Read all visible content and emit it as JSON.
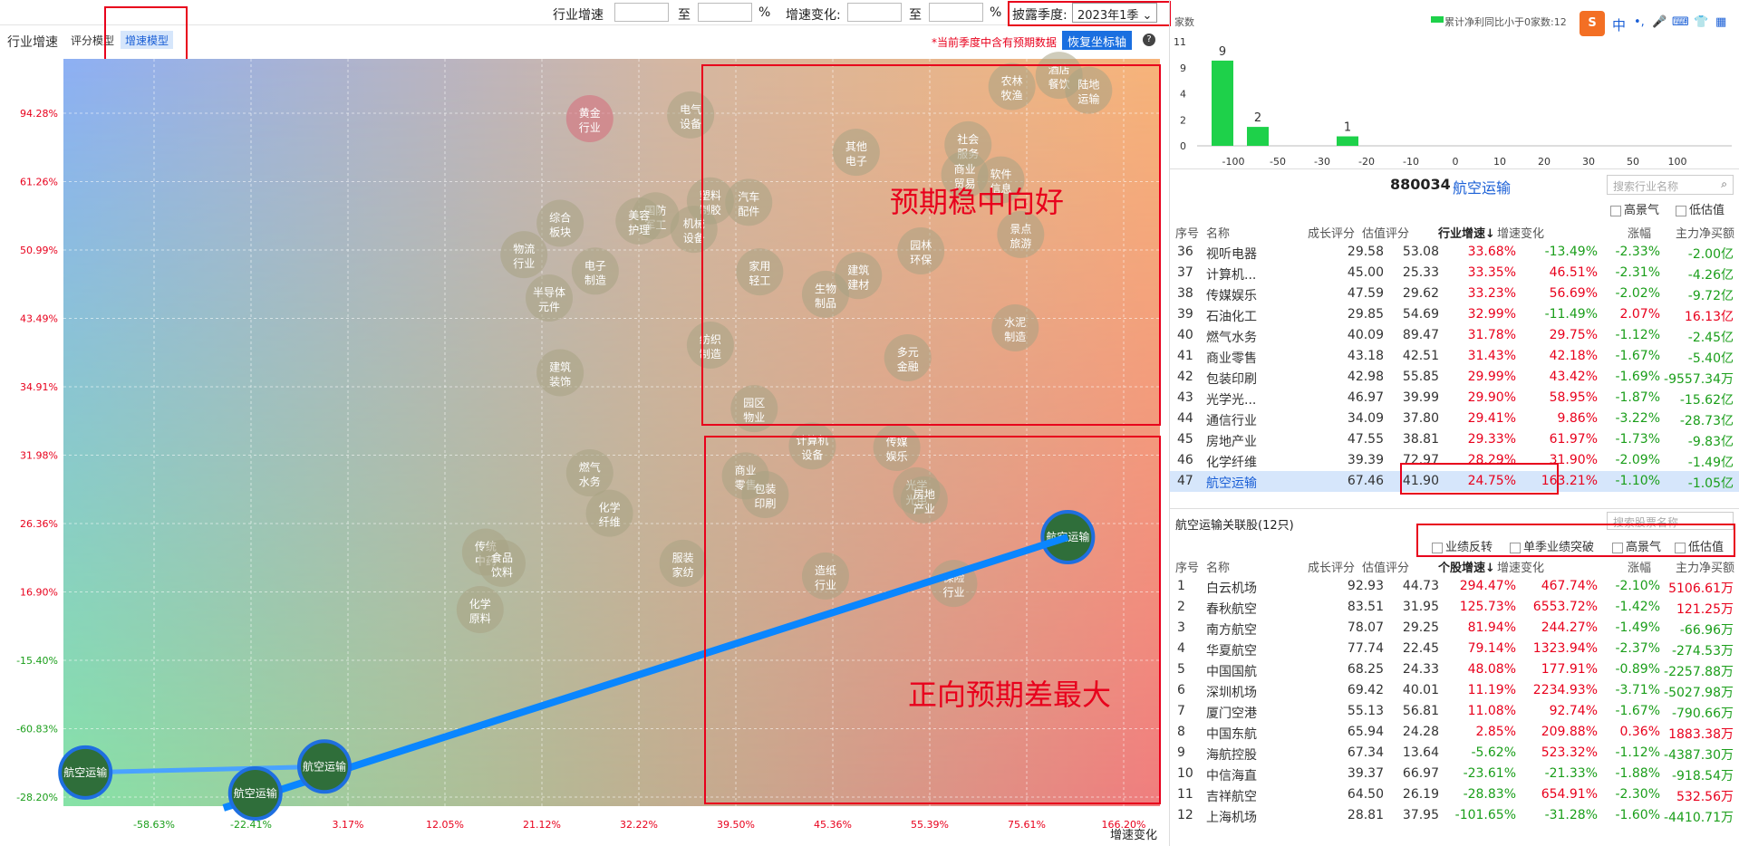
{
  "topbar": {
    "industry_growth_label": "行业增速",
    "to1": "至",
    "pct1": "%",
    "growth_change_label": "增速变化:",
    "to2": "至",
    "pct2": "%",
    "disclosure_label": "披露季度:",
    "disclosure_value": "2023年1季"
  },
  "subbar": {
    "title": "行业增速",
    "tab_score": "评分模型",
    "tab_speed": "增速模型",
    "note": "*当前季度中含有预期数据",
    "restore_button": "恢复坐标轴",
    "help_icon": "?"
  },
  "chart_data": {
    "type": "scatter",
    "xlabel": "增速变化",
    "ylabel": "",
    "x_ticks": [
      "-58.63%",
      "-22.41%",
      "3.17%",
      "12.05%",
      "21.12%",
      "32.22%",
      "39.50%",
      "45.36%",
      "55.39%",
      "75.61%",
      "166.20%"
    ],
    "y_ticks": [
      "94.28%",
      "61.26%",
      "50.99%",
      "43.49%",
      "34.91%",
      "31.98%",
      "26.36%",
      "16.90%",
      "-15.40%",
      "-60.83%",
      "-28.20%"
    ],
    "annotations": [
      "预期稳中向好",
      "正向预期差最大"
    ],
    "bubbles": [
      {
        "name": "黄金行业",
        "x": 0.48,
        "y": 0.92,
        "color": "#d56a7a"
      },
      {
        "name": "电气设备",
        "x": 0.572,
        "y": 0.925,
        "color": "#a7a383"
      },
      {
        "name": "农林牧渔",
        "x": 0.865,
        "y": 0.963,
        "color": "#a7a383"
      },
      {
        "name": "酒店餐饮",
        "x": 0.908,
        "y": 0.978,
        "color": "#a7a383"
      },
      {
        "name": "陆地运输",
        "x": 0.935,
        "y": 0.958,
        "color": "#a7a383"
      },
      {
        "name": "其他电子",
        "x": 0.723,
        "y": 0.875,
        "color": "#a7a383"
      },
      {
        "name": "社会服务",
        "x": 0.825,
        "y": 0.885,
        "color": "#a7a383"
      },
      {
        "name": "商业贸易",
        "x": 0.822,
        "y": 0.845,
        "color": "#a7a383"
      },
      {
        "name": "软件信息",
        "x": 0.855,
        "y": 0.838,
        "color": "#a7a383"
      },
      {
        "name": "塑料制胶",
        "x": 0.59,
        "y": 0.81,
        "color": "#a7a383"
      },
      {
        "name": "汽车配件",
        "x": 0.625,
        "y": 0.808,
        "color": "#a7a383"
      },
      {
        "name": "国防军工",
        "x": 0.54,
        "y": 0.79,
        "color": "#a7a383"
      },
      {
        "name": "美容护理",
        "x": 0.525,
        "y": 0.783,
        "color": "#a7a383"
      },
      {
        "name": "机械设备",
        "x": 0.575,
        "y": 0.772,
        "color": "#a7a383"
      },
      {
        "name": "综合板块",
        "x": 0.453,
        "y": 0.78,
        "color": "#a7a383"
      },
      {
        "name": "物流行业",
        "x": 0.42,
        "y": 0.738,
        "color": "#a7a383"
      },
      {
        "name": "电子制造",
        "x": 0.485,
        "y": 0.716,
        "color": "#a7a383"
      },
      {
        "name": "家用轻工",
        "x": 0.635,
        "y": 0.715,
        "color": "#a7a383"
      },
      {
        "name": "建筑建材",
        "x": 0.725,
        "y": 0.71,
        "color": "#a7a383"
      },
      {
        "name": "园林环保",
        "x": 0.782,
        "y": 0.743,
        "color": "#a7a383"
      },
      {
        "name": "景点旅游",
        "x": 0.873,
        "y": 0.765,
        "color": "#a7a383"
      },
      {
        "name": "生物制品",
        "x": 0.695,
        "y": 0.685,
        "color": "#a7a383"
      },
      {
        "name": "半导体元件",
        "x": 0.443,
        "y": 0.68,
        "color": "#a7a383"
      },
      {
        "name": "纺织制造",
        "x": 0.59,
        "y": 0.617,
        "color": "#a7a383"
      },
      {
        "name": "水泥制造",
        "x": 0.868,
        "y": 0.64,
        "color": "#a7a383"
      },
      {
        "name": "多元金融",
        "x": 0.77,
        "y": 0.6,
        "color": "#a7a383"
      },
      {
        "name": "建筑装饰",
        "x": 0.453,
        "y": 0.58,
        "color": "#a7a383"
      },
      {
        "name": "园区物业",
        "x": 0.63,
        "y": 0.532,
        "color": "#a7a383"
      },
      {
        "name": "计算机设备",
        "x": 0.683,
        "y": 0.482,
        "color": "#a7a383"
      },
      {
        "name": "传媒娱乐",
        "x": 0.76,
        "y": 0.48,
        "color": "#a7a383"
      },
      {
        "name": "燃气水务",
        "x": 0.48,
        "y": 0.446,
        "color": "#a7a383"
      },
      {
        "name": "商业零售",
        "x": 0.622,
        "y": 0.442,
        "color": "#a7a383"
      },
      {
        "name": "包装印刷",
        "x": 0.64,
        "y": 0.417,
        "color": "#a7a383"
      },
      {
        "name": "光学光电",
        "x": 0.778,
        "y": 0.422,
        "color": "#a7a383"
      },
      {
        "name": "房地产业",
        "x": 0.785,
        "y": 0.41,
        "color": "#a7a383"
      },
      {
        "name": "化学纤维",
        "x": 0.498,
        "y": 0.392,
        "color": "#a7a383"
      },
      {
        "name": "传统中药",
        "x": 0.385,
        "y": 0.34,
        "color": "#a7a383"
      },
      {
        "name": "食品饮料",
        "x": 0.4,
        "y": 0.325,
        "color": "#a7a383"
      },
      {
        "name": "服装家纺",
        "x": 0.565,
        "y": 0.325,
        "color": "#a7a383"
      },
      {
        "name": "造纸行业",
        "x": 0.695,
        "y": 0.308,
        "color": "#a7a383"
      },
      {
        "name": "保险行业",
        "x": 0.812,
        "y": 0.298,
        "color": "#a7a383"
      },
      {
        "name": "化学原料",
        "x": 0.38,
        "y": 0.263,
        "color": "#a7a383"
      },
      {
        "name": "航空运输",
        "x": 0.916,
        "y": 0.36,
        "color": "#2f6e3a"
      }
    ],
    "trail": [
      {
        "name": "航空运输",
        "x": 0.02,
        "y": 0.045
      },
      {
        "name": "航空运输",
        "x": 0.175,
        "y": 0.017
      },
      {
        "name": "航空运输",
        "x": 0.238,
        "y": 0.053
      },
      {
        "name": "航空运输",
        "x": 0.916,
        "y": 0.36
      }
    ]
  },
  "right": {
    "hist_title": "家数",
    "hist_legend": "累计净利同比小于0家数:12",
    "hist_y_ticks": [
      "11",
      "9",
      "4",
      "2",
      "0"
    ],
    "hist_x_ticks": [
      "-100",
      "-50",
      "-30",
      "-20",
      "-10",
      "0",
      "10",
      "20",
      "30",
      "50",
      "100"
    ],
    "hist_bars": [
      {
        "label": "9",
        "value": 9
      },
      {
        "label": "2",
        "value": 2
      },
      {
        "label": "1",
        "value": 1
      }
    ],
    "code": "880034",
    "name": "航空运输",
    "search_industry": "搜索行业名称",
    "high_sentiment": "高景气",
    "low_valuation": "低估值",
    "headers": [
      "序号",
      "名称",
      "成长评分",
      "估值评分",
      "行业增速↓",
      "增速变化",
      "涨幅",
      "主力净买额"
    ],
    "rows": [
      [
        "36",
        "视听电器",
        "29.58",
        "53.08",
        "33.68%",
        "-13.49%",
        "-2.33%",
        "-2.00亿"
      ],
      [
        "37",
        "计算机...",
        "45.00",
        "25.33",
        "33.35%",
        "46.51%",
        "-2.31%",
        "-4.26亿"
      ],
      [
        "38",
        "传媒娱乐",
        "47.59",
        "29.62",
        "33.23%",
        "56.69%",
        "-2.02%",
        "-9.72亿"
      ],
      [
        "39",
        "石油化工",
        "29.85",
        "54.69",
        "32.99%",
        "-11.49%",
        "2.07%",
        "16.13亿"
      ],
      [
        "40",
        "燃气水务",
        "40.09",
        "89.47",
        "31.78%",
        "29.75%",
        "-1.12%",
        "-2.45亿"
      ],
      [
        "41",
        "商业零售",
        "43.18",
        "42.51",
        "31.43%",
        "42.18%",
        "-1.67%",
        "-5.40亿"
      ],
      [
        "42",
        "包装印刷",
        "42.98",
        "55.85",
        "29.99%",
        "43.42%",
        "-1.69%",
        "-9557.34万"
      ],
      [
        "43",
        "光学光...",
        "46.97",
        "39.99",
        "29.90%",
        "58.95%",
        "-1.87%",
        "-15.62亿"
      ],
      [
        "44",
        "通信行业",
        "34.09",
        "37.80",
        "29.41%",
        "9.86%",
        "-3.22%",
        "-28.73亿"
      ],
      [
        "45",
        "房地产业",
        "47.55",
        "38.81",
        "29.33%",
        "61.97%",
        "-1.73%",
        "-9.83亿"
      ],
      [
        "46",
        "化学纤维",
        "39.39",
        "72.97",
        "28.29%",
        "31.90%",
        "-2.09%",
        "-1.49亿"
      ],
      [
        "47",
        "航空运输",
        "67.46",
        "41.90",
        "24.75%",
        "163.21%",
        "-1.10%",
        "-1.05亿"
      ]
    ],
    "stocks_title": "航空运输关联股(12只)",
    "search_stock": "搜索股票名称",
    "filters": [
      "业绩反转",
      "单季业绩突破",
      "高景气",
      "低估值"
    ],
    "stock_headers": [
      "序号",
      "名称",
      "成长评分",
      "估值评分",
      "个股增速↓",
      "增速变化",
      "涨幅",
      "主力净买额"
    ],
    "stocks": [
      [
        "1",
        "白云机场",
        "92.93",
        "44.73",
        "294.47%",
        "467.74%",
        "-2.10%",
        "5106.61万"
      ],
      [
        "2",
        "春秋航空",
        "83.51",
        "31.95",
        "125.73%",
        "6553.72%",
        "-1.42%",
        "121.25万"
      ],
      [
        "3",
        "南方航空",
        "78.07",
        "29.25",
        "81.94%",
        "244.27%",
        "-1.49%",
        "-66.96万"
      ],
      [
        "4",
        "华夏航空",
        "77.74",
        "22.45",
        "79.14%",
        "1323.94%",
        "-2.37%",
        "-274.53万"
      ],
      [
        "5",
        "中国国航",
        "68.25",
        "24.33",
        "48.08%",
        "177.91%",
        "-0.89%",
        "-2257.88万"
      ],
      [
        "6",
        "深圳机场",
        "69.42",
        "40.01",
        "11.19%",
        "2234.93%",
        "-3.71%",
        "-5027.98万"
      ],
      [
        "7",
        "厦门空港",
        "55.13",
        "56.81",
        "11.08%",
        "92.74%",
        "-1.67%",
        "-790.66万"
      ],
      [
        "8",
        "中国东航",
        "65.94",
        "24.28",
        "2.85%",
        "209.88%",
        "0.36%",
        "1883.38万"
      ],
      [
        "9",
        "海航控股",
        "67.34",
        "13.64",
        "-5.62%",
        "523.32%",
        "-1.12%",
        "-4387.30万"
      ],
      [
        "10",
        "中信海直",
        "39.37",
        "66.97",
        "-23.61%",
        "-21.33%",
        "-1.88%",
        "-918.54万"
      ],
      [
        "11",
        "吉祥航空",
        "64.50",
        "26.19",
        "-28.83%",
        "654.91%",
        "-2.30%",
        "532.56万"
      ],
      [
        "12",
        "上海机场",
        "28.81",
        "37.95",
        "-101.65%",
        "-31.28%",
        "-1.60%",
        "-4410.71万"
      ]
    ],
    "ime": [
      "S",
      "中",
      "•,",
      "🎤",
      "⌨",
      "👕",
      "▦"
    ]
  }
}
